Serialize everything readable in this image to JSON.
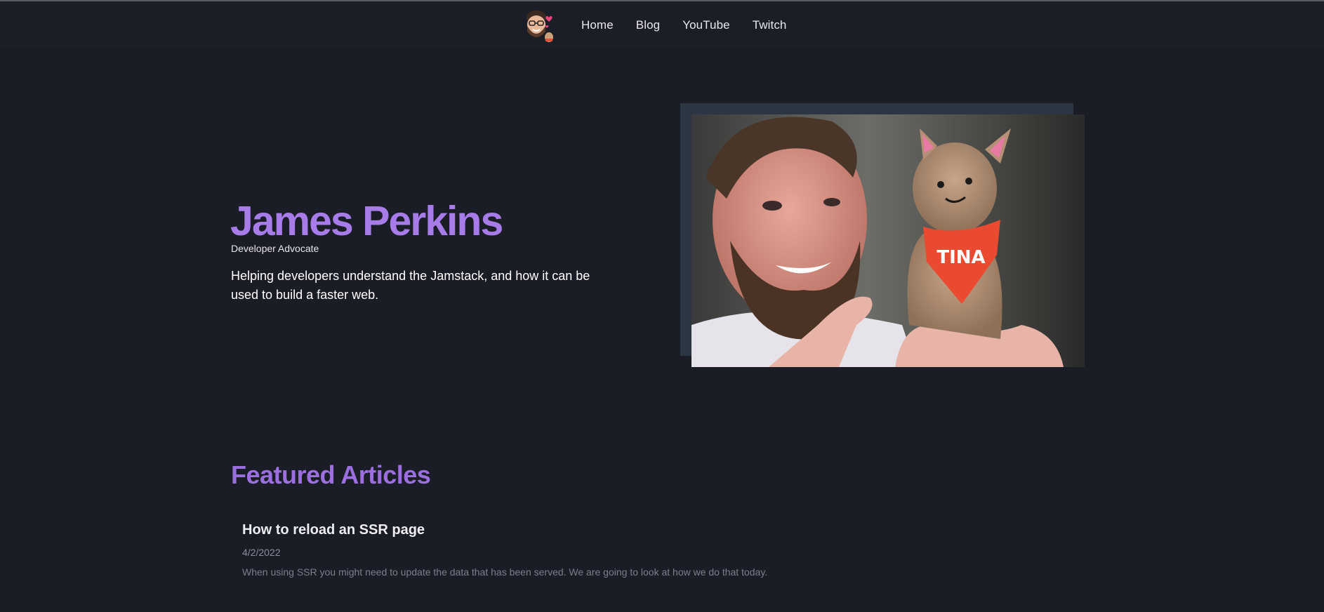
{
  "nav": {
    "links": [
      "Home",
      "Blog",
      "YouTube",
      "Twitch"
    ]
  },
  "hero": {
    "name": "James Perkins",
    "role": "Developer Advocate",
    "description": "Helping developers understand the Jamstack, and how it can be used to build a faster web.",
    "photo_badge_text": "TINA"
  },
  "featured": {
    "title": "Featured Articles",
    "articles": [
      {
        "title": "How to reload an SSR page",
        "date": "4/2/2022",
        "excerpt": "When using SSR you might need to update the data that has been served. We are going to look at how we do that today."
      }
    ]
  },
  "colors": {
    "background": "#1a1d26",
    "accent": "#a77ce8",
    "photo_frame": "#2c3542"
  }
}
